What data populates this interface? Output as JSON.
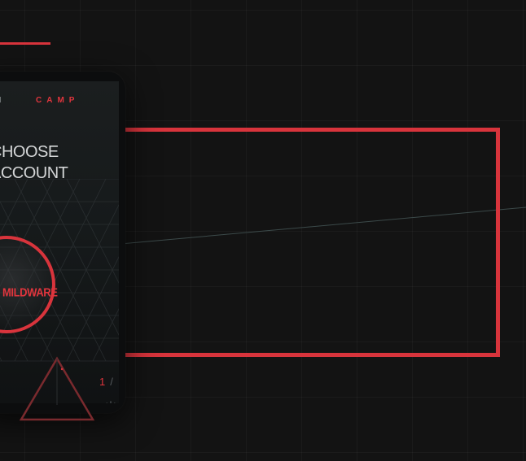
{
  "brand": {
    "prefix": "O N",
    "name": "CAMP"
  },
  "screen": {
    "heading_line1": "CHOOSE",
    "heading_line2": "ACCOUNT"
  },
  "account": {
    "label": "MILDWARE"
  },
  "pager": {
    "current": "1",
    "separator": "/"
  },
  "colors": {
    "accent": "#d8343c",
    "background": "#131313",
    "text": "#d4d6d7"
  },
  "icons": {
    "settings": "gear-icon",
    "triangle": "triangle-icon"
  }
}
